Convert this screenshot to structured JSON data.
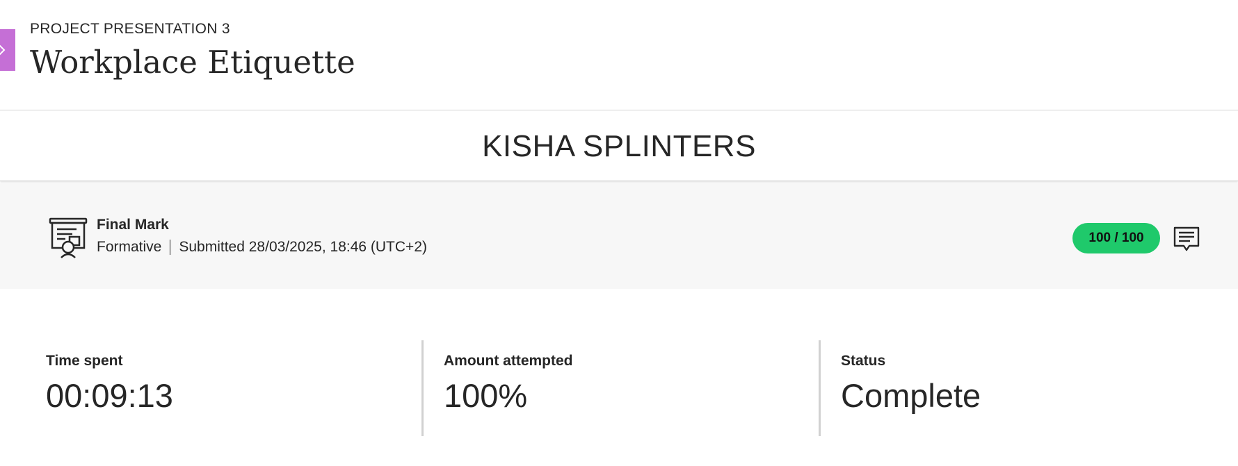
{
  "header": {
    "eyebrow": "PROJECT PRESENTATION 3",
    "title": "Workplace Etiquette",
    "accent_color": "#c56fd6"
  },
  "student": {
    "name": "KISHA SPLINTERS"
  },
  "grade": {
    "icon": "presentation-certificate-icon",
    "label": "Final Mark",
    "type": "Formative",
    "submitted": "Submitted 28/03/2025, 18:46 (UTC+2)",
    "score": "100 / 100",
    "score_color": "#1fc96b",
    "feedback_icon": "comment-icon"
  },
  "stats": {
    "time_spent": {
      "label": "Time spent",
      "value": "00:09:13"
    },
    "amount_attempted": {
      "label": "Amount attempted",
      "value": "100%"
    },
    "status": {
      "label": "Status",
      "value": "Complete"
    }
  }
}
